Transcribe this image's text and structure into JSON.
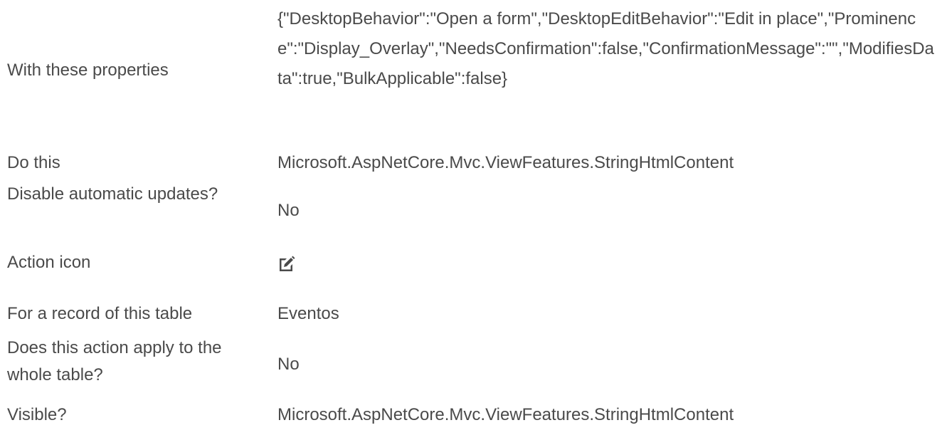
{
  "properties": {
    "with_these_properties": {
      "label": "With these properties",
      "value": "{\"DesktopBehavior\":\"Open a form\",\"DesktopEditBehavior\":\"Edit in place\",\"Prominence\":\"Display_Overlay\",\"NeedsConfirmation\":false,\"ConfirmationMessage\":\"\",\"ModifiesData\":true,\"BulkApplicable\":false}"
    },
    "do_this": {
      "label": "Do this",
      "value": "Microsoft.AspNetCore.Mvc.ViewFeatures.StringHtmlContent"
    },
    "disable_updates": {
      "label": "Disable automatic updates?",
      "value": "No"
    },
    "action_icon": {
      "label": "Action icon",
      "icon": "edit-icon"
    },
    "record_table": {
      "label": "For a record of this table",
      "value": "Eventos"
    },
    "whole_table": {
      "label": "Does this action apply to the whole table?",
      "value": "No"
    },
    "visible": {
      "label": "Visible?",
      "value": "Microsoft.AspNetCore.Mvc.ViewFeatures.StringHtmlContent"
    }
  }
}
